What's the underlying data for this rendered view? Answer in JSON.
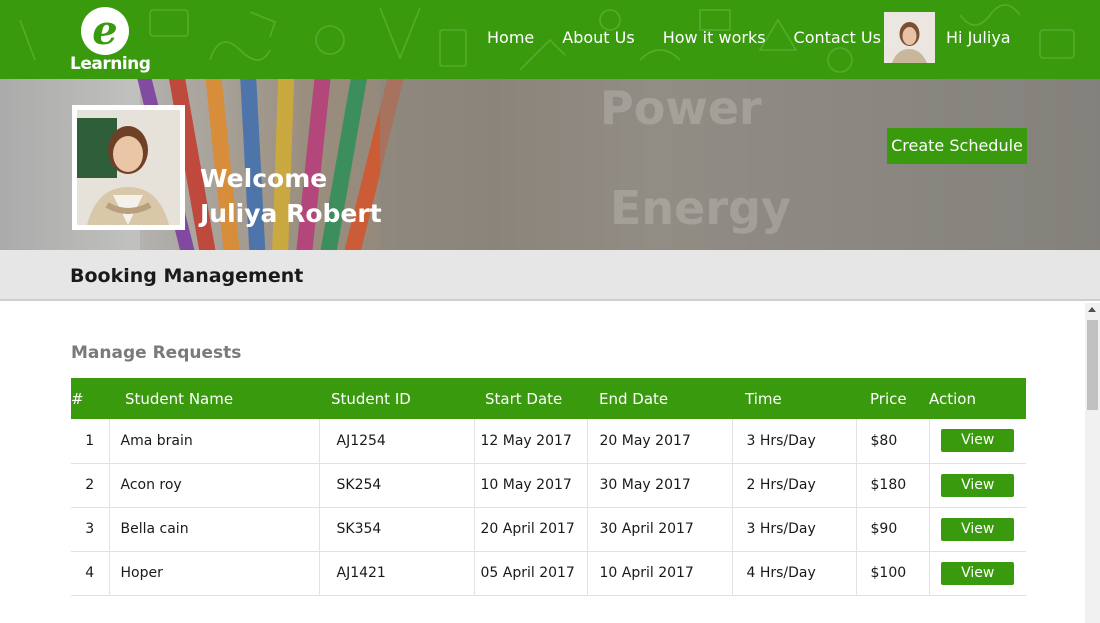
{
  "brand": {
    "logo_letter": "e",
    "logo_text": "Learning"
  },
  "nav": {
    "items": [
      "Home",
      "About Us",
      "How it works",
      "Contact Us"
    ]
  },
  "user": {
    "greeting": "Hi Juliya"
  },
  "banner": {
    "welcome_line1": "Welcome",
    "welcome_line2": "Juliya Robert",
    "create_button": "Create Schedule"
  },
  "section": {
    "title": "Booking Management"
  },
  "requests": {
    "title": "Manage Requests",
    "columns": [
      "#",
      "Student Name",
      "Student ID",
      "Start Date",
      "End Date",
      "Time",
      "Price",
      "Action"
    ],
    "rows": [
      {
        "num": "1",
        "name": "Ama brain",
        "id": "AJ1254",
        "start": "12 May 2017",
        "end": "20 May 2017",
        "time": "3 Hrs/Day",
        "price": "$80",
        "action": "View"
      },
      {
        "num": "2",
        "name": "Acon roy",
        "id": "SK254",
        "start": "10 May 2017",
        "end": "30 May 2017",
        "time": "2 Hrs/Day",
        "price": "$180",
        "action": "View"
      },
      {
        "num": "3",
        "name": "Bella cain",
        "id": "SK354",
        "start": "20 April 2017",
        "end": "30 April 2017",
        "time": "3 Hrs/Day",
        "price": "$90",
        "action": "View"
      },
      {
        "num": "4",
        "name": "Hoper",
        "id": "AJ1421",
        "start": "05 April 2017",
        "end": "10 April 2017",
        "time": "4 Hrs/Day",
        "price": "$100",
        "action": "View"
      }
    ]
  },
  "colors": {
    "brand_green": "#3a9a0e",
    "section_bg": "#e6e6e6",
    "subtitle_gray": "#7a7a7a"
  }
}
